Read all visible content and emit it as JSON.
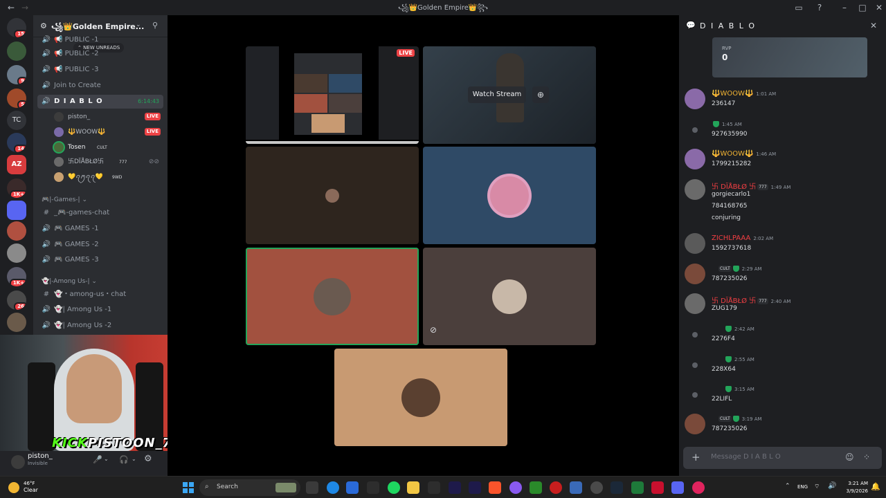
{
  "window": {
    "title": "꧁👑Golden Empire👑꧂"
  },
  "guild": {
    "name": "꧁👑Golden Empire..."
  },
  "channels": {
    "new_unreads": "NEW UNREADS",
    "items": [
      {
        "label": "📢 PUBLIC -1"
      },
      {
        "label": "📢 PUBLIC -2"
      },
      {
        "label": "📢 PUBLIC -3"
      },
      {
        "label": "Join to Create"
      },
      {
        "label": "D I A B L O",
        "timer": "6:14:43"
      }
    ],
    "voice_users": [
      {
        "name": "piston_",
        "live": "LIVE"
      },
      {
        "name": "🔱WOOW🔱",
        "live": "LIVE"
      },
      {
        "name": "Tosen",
        "tag": "CULT"
      },
      {
        "name": "卐DÏÅBŁØ卐",
        "tag": "777"
      },
      {
        "name": "💛ꪖꪑꪖꪖ💛",
        "tag": "9WD"
      }
    ],
    "games_category": "🎮|-Games-|",
    "games_items": [
      {
        "label": "_🎮-games-chat"
      },
      {
        "label": "🎮 GAMES -1"
      },
      {
        "label": "🎮 GAMES -2"
      },
      {
        "label": "🎮 GAMES -3"
      }
    ],
    "among_category": "👻|-Among Us-|",
    "among_items": [
      {
        "label": "👻・among-us・chat"
      },
      {
        "label": "👻| Among Us -1"
      },
      {
        "label": "👻| Among Us -2"
      }
    ]
  },
  "webcam": {
    "overlay_kick": "KICK",
    "overlay_name": "PISTOON_7"
  },
  "user": {
    "name": "piston_",
    "status": "Invisible"
  },
  "stage": {
    "live_badge": "LIVE",
    "watch_stream": "Watch Stream"
  },
  "chat": {
    "channel_name": "D I A B L O",
    "rvp_label": "RVP",
    "rvp_value": "0",
    "messages": [
      {
        "author": "🔱WOOW🔱",
        "time": "1:01 AM",
        "lines": [
          "236147"
        ],
        "color": "#f0b232"
      },
      {
        "author": "",
        "time": "1:45 AM",
        "lines": [
          "927635990"
        ],
        "color": "#dbdee1"
      },
      {
        "author": "🔱WOOW🔱",
        "time": "1:46 AM",
        "lines": [
          "1799215282"
        ],
        "color": "#f0b232"
      },
      {
        "author": "卐 DÏÅBŁØ 卐",
        "tag": "777",
        "time": "1:49 AM",
        "lines": [
          "gorgiecarlo1",
          "784168765",
          "conjuring"
        ],
        "color": "#f23f43"
      },
      {
        "author": "ZICHLPAAA",
        "time": "2:02 AM",
        "lines": [
          "1592737618"
        ],
        "color": "#f23f43"
      },
      {
        "author": "",
        "tag": "CULT",
        "time": "2:29 AM",
        "lines": [
          "787235026"
        ],
        "color": "#dbdee1"
      },
      {
        "author": "卐 DÏÅBŁØ 卐",
        "tag": "777",
        "time": "2:40 AM",
        "lines": [
          "ZUG179"
        ],
        "color": "#f23f43"
      },
      {
        "author": "",
        "time": "2:42 AM",
        "lines": [
          "2276F4"
        ],
        "color": "#dbdee1"
      },
      {
        "author": "",
        "time": "2:55 AM",
        "lines": [
          "228X64"
        ],
        "color": "#dbdee1"
      },
      {
        "author": "",
        "time": "3:15 AM",
        "lines": [
          "22LIFL"
        ],
        "color": "#dbdee1"
      },
      {
        "author": "",
        "tag": "CULT",
        "time": "3:19 AM",
        "lines": [
          "787235026"
        ],
        "color": "#dbdee1"
      }
    ],
    "composer_placeholder": "Message D I A B L O"
  },
  "taskbar": {
    "weather_temp": "46°F",
    "weather_desc": "Clear",
    "search": "Search",
    "lang": "ENG",
    "time": "3:21 AM",
    "date": "3/9/2026"
  },
  "colors": {
    "accent_green": "#23a55a",
    "live_red": "#ed4245",
    "tile_brown": "#2e251e",
    "tile_blue": "#2f4a66",
    "tile_rust": "#a2513f",
    "tile_gray": "#4b3f3c",
    "tile_tan": "#c89a72"
  }
}
